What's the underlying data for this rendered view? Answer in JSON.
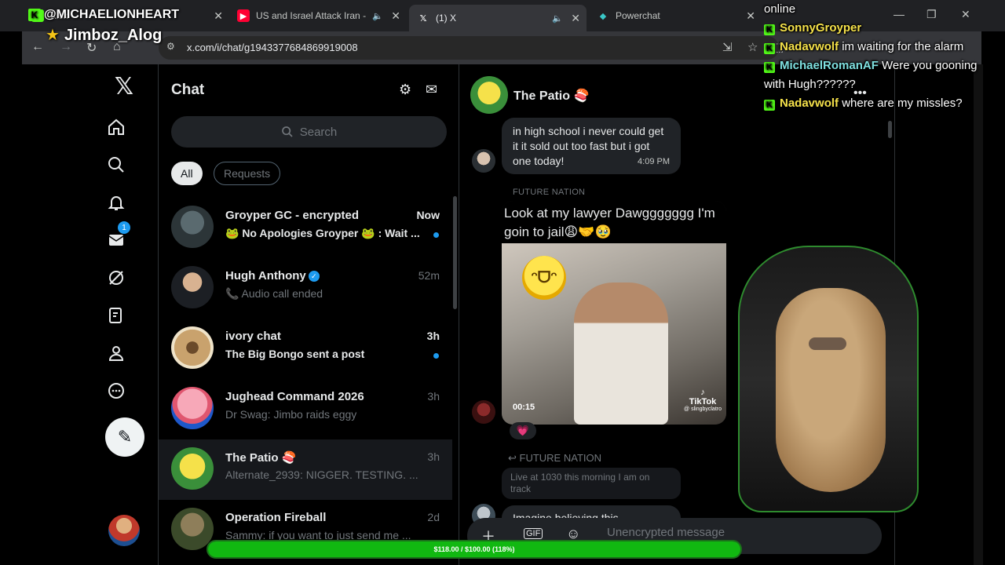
{
  "browser": {
    "tabs": [
      {
        "title": "Kick",
        "active": false
      },
      {
        "title": "US and Israel Attack Iran - L",
        "active": false
      },
      {
        "title": "(1) X",
        "active": true
      },
      {
        "title": "Powerchat",
        "active": false
      }
    ],
    "url": "x.com/i/chat/g1943377684869919008"
  },
  "overlay": {
    "streamer": "@MICHAELIONHEART",
    "mod_name": "Jimboz_Alog",
    "chat_header": "online",
    "chat": [
      {
        "user": "SonnyGroyper",
        "text": "",
        "color": "#f5e14a"
      },
      {
        "user": "Nadavwolf",
        "text": "im waiting for the alarm",
        "color": "#f5e14a"
      },
      {
        "user": "MichaelRomanAF",
        "text": "Were you gooning with Hugh??????",
        "color": "#7fe0e0"
      },
      {
        "user": "Nadavwolf",
        "text": "where are my missles?",
        "color": "#f5e14a"
      }
    ],
    "progress": {
      "label": "$118.00 / $100.00 (118%)",
      "fraction": 1.0
    }
  },
  "nav": {
    "messages_badge": "1"
  },
  "chat": {
    "title": "Chat",
    "search_placeholder": "Search",
    "filters": {
      "all": "All",
      "requests": "Requests"
    },
    "conversations": [
      {
        "name": "Groyper GC - encrypted",
        "time": "Now",
        "preview": "🐸 No Apologies Groyper 🐸 : Wait ...",
        "unread": true
      },
      {
        "name": "Hugh Anthony",
        "time": "52m",
        "preview": "📞 Audio call ended",
        "unread": false,
        "verified": true
      },
      {
        "name": "ivory chat",
        "time": "3h",
        "preview": "The Big Bongo sent a post",
        "unread": true
      },
      {
        "name": "Jughead Command 2026",
        "time": "3h",
        "preview": "Dr Swag: Jimbo raids eggy",
        "unread": false
      },
      {
        "name": "The Patio 🍣",
        "time": "3h",
        "preview": "Alternate_2939: NIGGER. TESTING. ...",
        "unread": false,
        "selected": true
      },
      {
        "name": "Operation Fireball",
        "time": "2d",
        "preview": "Sammy: if you want to just send me ...",
        "unread": false
      }
    ]
  },
  "conversation": {
    "title": "The Patio 🍣",
    "messages": [
      {
        "text": "in high school i never could get it it sold out too fast but i got one today!",
        "time": "4:09 PM"
      }
    ],
    "media": {
      "sender": "FUTURE NATION",
      "caption": "Look at my lawyer Dawggggggg I'm goin to jail😩🤝🥹",
      "duration": "00:15",
      "watermark": "TikTok",
      "watermark_handle": "@ slingbyclatro",
      "reaction": "💗"
    },
    "reply": {
      "to": "FUTURE NATION",
      "quote": "Live at 1030 this morning I am on track",
      "text": "Imagine believing this"
    },
    "composer_placeholder": "Unencrypted message"
  }
}
